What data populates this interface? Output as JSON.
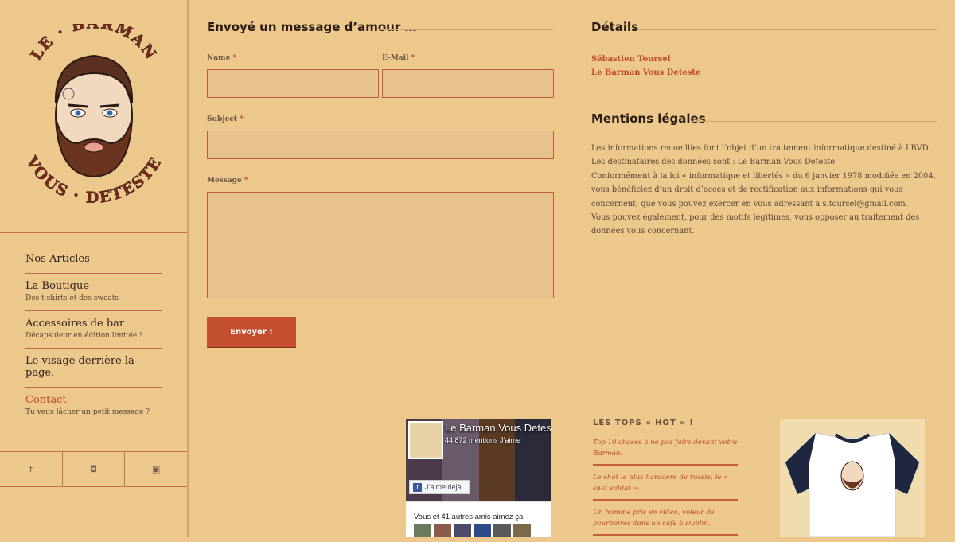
{
  "logo": {
    "alt": "Le Barman Vous Deteste",
    "top_text": "LE · BARMAN",
    "bottom_text": "VOUS · DETESTE"
  },
  "nav": [
    {
      "label": "Nos Articles",
      "sub": ""
    },
    {
      "label": "La Boutique",
      "sub": "Des t-shirts et des sweats"
    },
    {
      "label": "Accessoires de bar",
      "sub": "Décapsuleur en édition limitée !"
    },
    {
      "label": "Le visage derrière la page.",
      "sub": ""
    },
    {
      "label": "Contact",
      "sub": "Tu veux lâcher un petit message ?"
    }
  ],
  "social": {
    "facebook": "f",
    "instagram": "◘",
    "youtube": "▣"
  },
  "contact": {
    "heading": "Envoyé un message d’amour …",
    "name_label": "Name",
    "email_label": "E-Mail",
    "subject_label": "Subject",
    "message_label": "Message",
    "required_mark": "*",
    "submit_label": "Envoyer !"
  },
  "details": {
    "heading": "Détails",
    "name": "Sébastien Toursel",
    "site": "Le Barman Vous Deteste"
  },
  "legal": {
    "heading": "Mentions légales",
    "p1": "Les informations recueillies font l’objet d’un traitement informatique destiné à LBVD . Les destinataires des données sont : Le Barman Vous Deteste.",
    "p2": "Conformément à la loi « informatique et libertés » du 6 janvier 1978 modifiée en 2004, vous bénéficiez d’un droit d’accès et de rectification aux informations qui vous concernent, que vous pouvez exercer en vous adressant à s.toursel@gmail.com.",
    "p3": "Vous pouvez également, pour des motifs légitimes, vous opposer au traitement des données vous concernant."
  },
  "facebook": {
    "page_name": "Le Barman Vous Deteste",
    "likes": "44 872 mentions J’aime",
    "like_button": "J’aime déjà",
    "friends_text": "Vous et 41 autres amis aimez ça"
  },
  "tops": {
    "heading": "LES TOPS « HOT » !",
    "items": [
      "Top 10 choses à ne pas faire devant votre Barman.",
      "Le shot le plus hardcore de russie, le « shot soldat ».",
      "Un homme pris en vidéo, voleur de pourboires dans un café à Dublin."
    ]
  }
}
